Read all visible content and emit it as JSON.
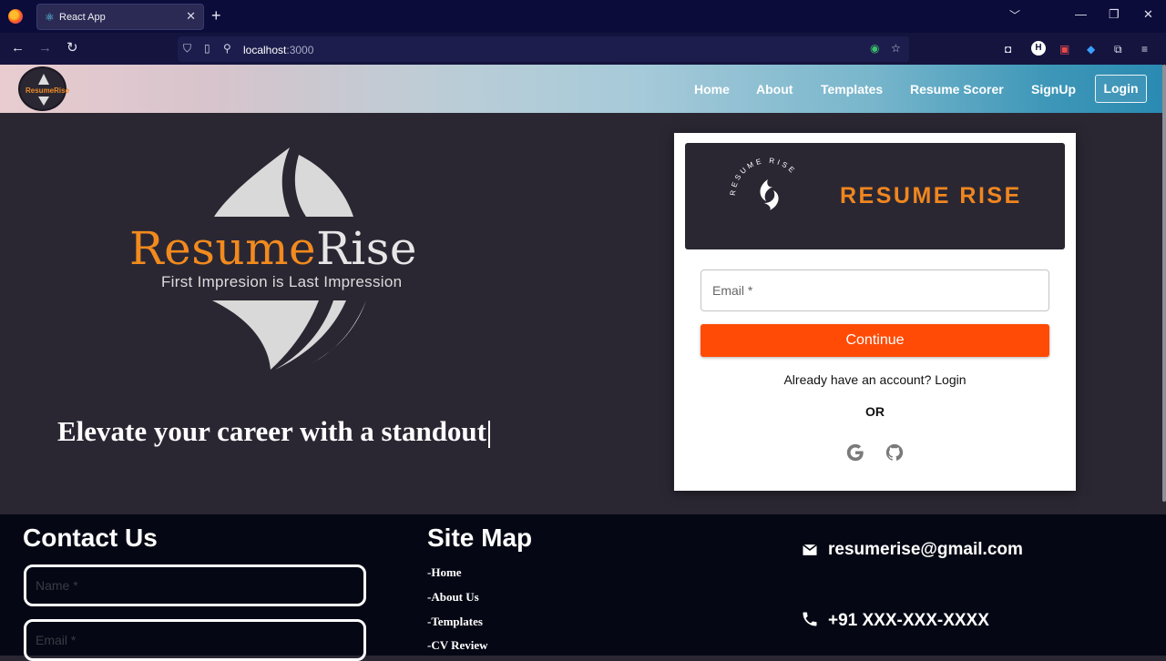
{
  "browser": {
    "tab_title": "React App",
    "url_host": "localhost",
    "url_port": ":3000"
  },
  "header": {
    "logo_text": "ResumeRise",
    "menu": [
      "Home",
      "About",
      "Templates",
      "Resume Scorer",
      "SignUp"
    ],
    "login_label": "Login"
  },
  "hero": {
    "brand_first": "Resume",
    "brand_second": "Rise",
    "tagline": "First Impresion is Last Impression",
    "headline": "Elevate your career with a standout"
  },
  "card": {
    "seal_text": "RESUME RISE",
    "banner_title": "RESUME RISE",
    "email_placeholder": "Email *",
    "continue_label": "Continue",
    "login_prompt": "Already have an account? Login",
    "or_label": "OR",
    "social_icons": [
      "google-icon",
      "github-icon"
    ]
  },
  "footer": {
    "contact_heading": "Contact Us",
    "name_placeholder": "Name *",
    "email_placeholder": "Email *",
    "sitemap_heading": "Site Map",
    "sitemap_links": [
      "-Home",
      "-About Us",
      "-Templates",
      "-CV Review"
    ],
    "email": "resumerise@gmail.com",
    "phone": "+91 XXX-XXX-XXXX"
  },
  "colors": {
    "accent_orange": "#f28a1e",
    "continue_button": "#ff4b06",
    "page_background": "#2a2733",
    "footer_background": "#050814"
  }
}
